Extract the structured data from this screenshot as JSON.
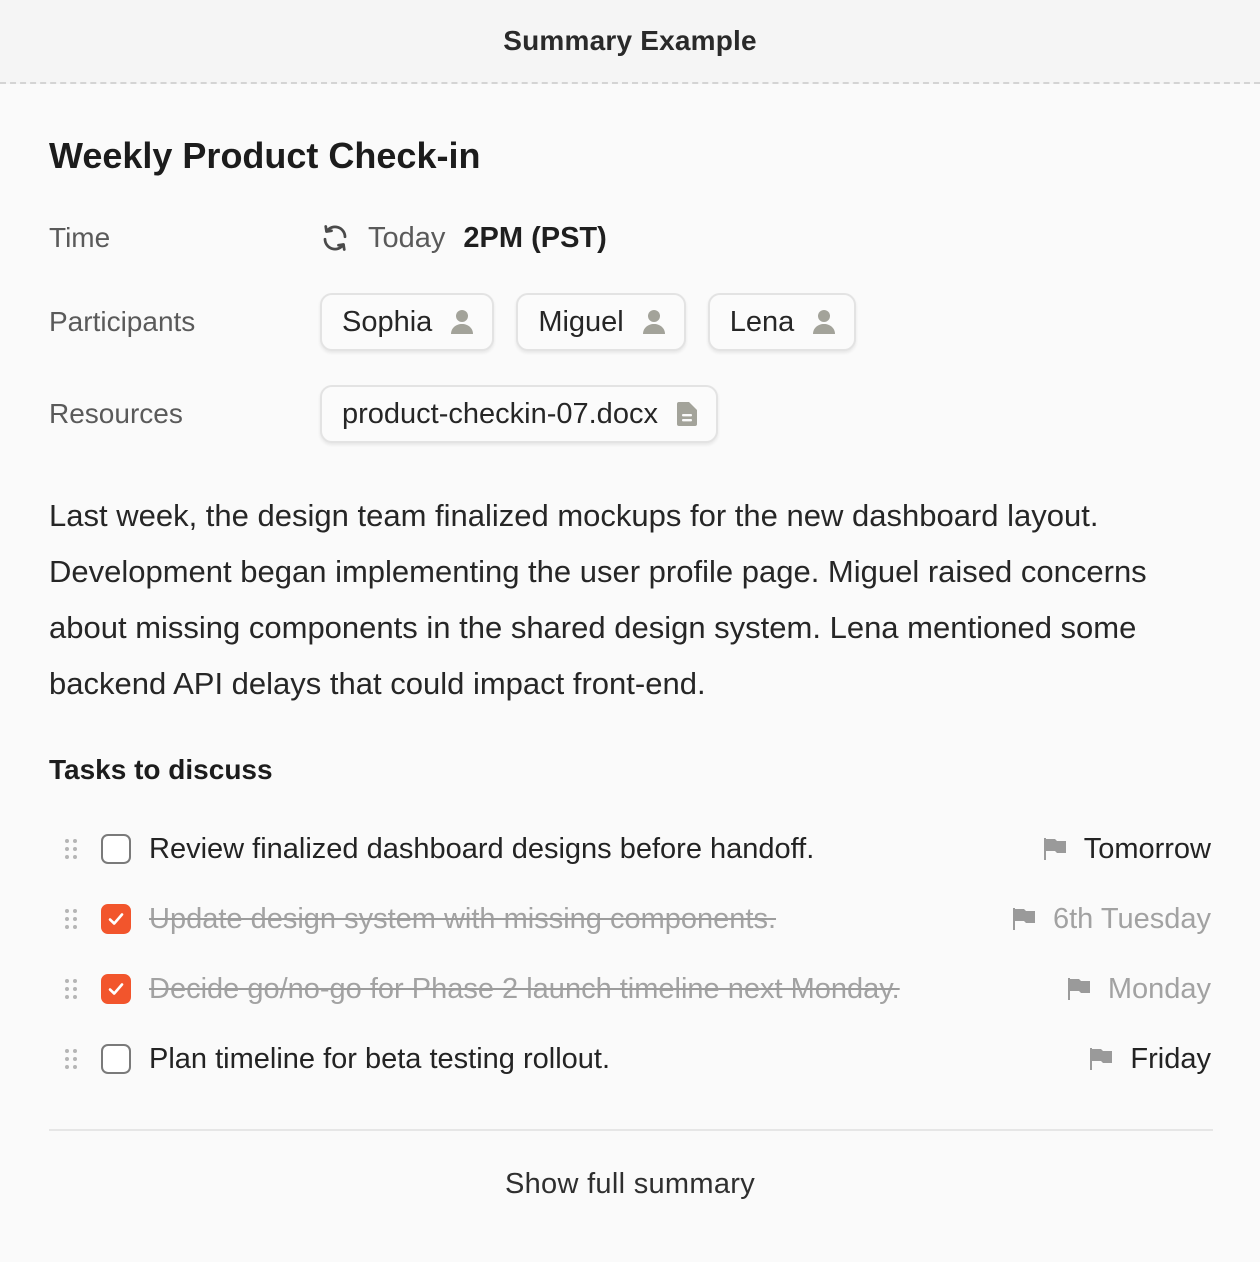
{
  "header": {
    "title": "Summary Example"
  },
  "meeting": {
    "title": "Weekly Product Check-in",
    "time": {
      "label": "Time",
      "icon": "refresh-icon",
      "day": "Today",
      "hour": "2PM (PST)"
    },
    "participants": {
      "label": "Participants",
      "people": [
        {
          "name": "Sophia",
          "icon": "person-icon"
        },
        {
          "name": "Miguel",
          "icon": "person-icon"
        },
        {
          "name": "Lena",
          "icon": "person-icon"
        }
      ]
    },
    "resources": {
      "label": "Resources",
      "files": [
        {
          "name": "product-checkin-07.docx",
          "icon": "document-icon"
        }
      ]
    },
    "description": "Last week, the design team finalized mockups for the new dashboard layout. Development began implementing the user profile page. Miguel raised concerns about missing components in the shared design system. Lena mentioned some backend API delays that could impact front-end."
  },
  "tasks": {
    "heading": "Tasks to discuss",
    "items": [
      {
        "text": "Review finalized dashboard designs before handoff.",
        "due": "Tomorrow",
        "done": false
      },
      {
        "text": "Update design system with missing components.",
        "due": "6th Tuesday",
        "done": true
      },
      {
        "text": "Decide go/no-go for Phase 2 launch timeline next Monday.",
        "due": "Monday",
        "done": true
      },
      {
        "text": "Plan timeline for beta testing rollout.",
        "due": "Friday",
        "done": false
      }
    ]
  },
  "footer": {
    "show_full_label": "Show full summary"
  },
  "colors": {
    "accent": "#f2552c",
    "icon_gray": "#a3a39a",
    "muted_text": "#a2a2a2"
  }
}
